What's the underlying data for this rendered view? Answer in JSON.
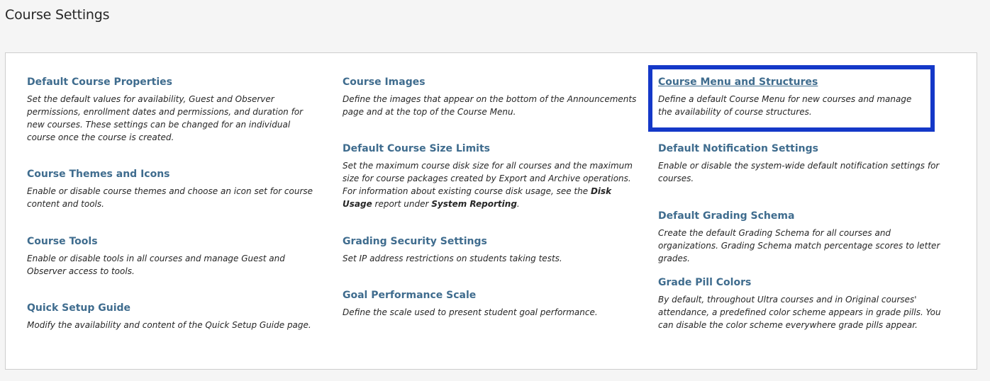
{
  "page": {
    "title": "Course Settings"
  },
  "settings": {
    "default_course_properties": {
      "title": "Default Course Properties",
      "desc": "Set the default values for availability, Guest and Observer permissions, enrollment dates and permissions, and duration for new courses. These settings can be changed for an individual course once the course is created."
    },
    "course_themes_and_icons": {
      "title": "Course Themes and Icons",
      "desc": "Enable or disable course themes and choose an icon set for course content and tools."
    },
    "course_tools": {
      "title": "Course Tools",
      "desc": "Enable or disable tools in all courses and manage Guest and Observer access to tools."
    },
    "quick_setup_guide": {
      "title": "Quick Setup Guide",
      "desc": "Modify the availability and content of the Quick Setup Guide page."
    },
    "course_images": {
      "title": "Course Images",
      "desc": "Define the images that appear on the bottom of the Announcements page and at the top of the Course Menu."
    },
    "default_course_size_limits": {
      "title": "Default Course Size Limits",
      "desc_part1": "Set the maximum course disk size for all courses and the maximum size for course packages created by Export and Archive operations. For information about existing course disk usage, see the ",
      "desc_bold1": "Disk Usage",
      "desc_part2": " report under ",
      "desc_bold2": "System Reporting",
      "desc_part3": "."
    },
    "grading_security_settings": {
      "title": "Grading Security Settings",
      "desc": "Set IP address restrictions on students taking tests."
    },
    "goal_performance_scale": {
      "title": "Goal Performance Scale",
      "desc": "Define the scale used to present student goal performance."
    },
    "course_menu_and_structures": {
      "title": "Course Menu and Structures",
      "desc": "Define a default Course Menu for new courses and manage the availability of course structures."
    },
    "default_notification_settings": {
      "title": "Default Notification Settings",
      "desc": "Enable or disable the system-wide default notification settings for courses."
    },
    "default_grading_schema": {
      "title": "Default Grading Schema",
      "desc": "Create the default Grading Schema for all courses and organizations. Grading Schema match percentage scores to letter grades."
    },
    "grade_pill_colors": {
      "title": "Grade Pill Colors",
      "desc": "By default, throughout Ultra courses and in Original courses' attendance, a predefined color scheme appears in grade pills. You can disable the color scheme everywhere grade pills appear."
    }
  },
  "colors": {
    "link": "#3f6c8e",
    "highlight": "#1438c8",
    "text": "#262626"
  }
}
